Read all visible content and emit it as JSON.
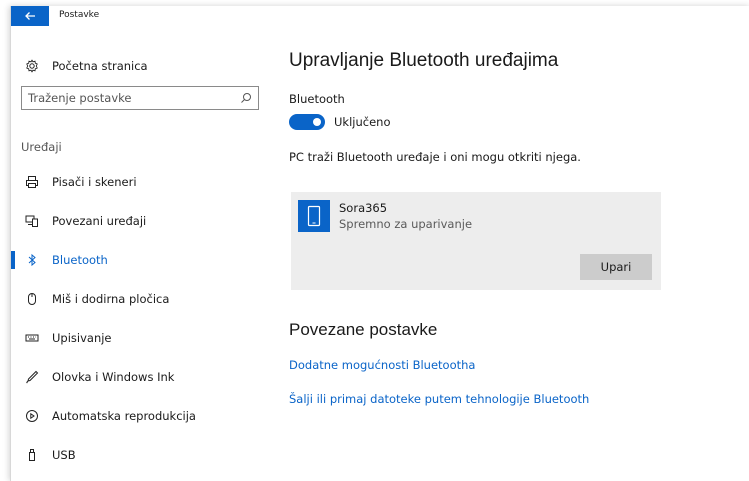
{
  "window": {
    "title": "Postavke"
  },
  "sidebar": {
    "home_label": "Početna stranica",
    "search_placeholder": "Traženje postavke",
    "section": "Uređaji",
    "items": [
      {
        "label": "Pisači i skeneri",
        "icon": "printer-icon"
      },
      {
        "label": "Povezani uređaji",
        "icon": "connected-devices-icon"
      },
      {
        "label": "Bluetooth",
        "icon": "bluetooth-icon",
        "active": true
      },
      {
        "label": "Miš i dodirna pločica",
        "icon": "mouse-icon"
      },
      {
        "label": "Upisivanje",
        "icon": "keyboard-icon"
      },
      {
        "label": "Olovka i Windows Ink",
        "icon": "pen-icon"
      },
      {
        "label": "Automatska reprodukcija",
        "icon": "autoplay-icon"
      },
      {
        "label": "USB",
        "icon": "usb-icon"
      }
    ]
  },
  "main": {
    "title": "Upravljanje Bluetooth uređajima",
    "bluetooth_label": "Bluetooth",
    "toggle_state": "Uključeno",
    "description": "PC traži Bluetooth uređaje i oni mogu otkriti njega.",
    "device": {
      "name": "Sora365",
      "status": "Spremno za uparivanje",
      "pair_label": "Upari"
    },
    "related_title": "Povezane postavke",
    "links": [
      "Dodatne mogućnosti Bluetootha",
      "Šalji ili primaj datoteke putem tehnologije Bluetooth"
    ]
  },
  "colors": {
    "accent": "#0a64c8",
    "card_bg": "#ededed",
    "button_bg": "#cccccc"
  }
}
